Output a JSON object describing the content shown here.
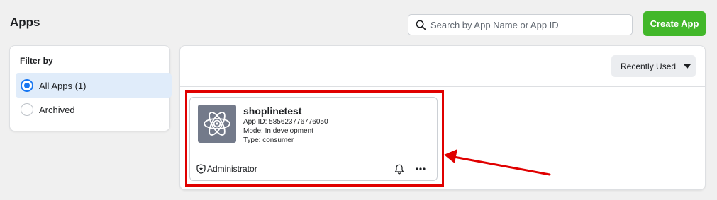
{
  "header": {
    "title": "Apps",
    "search_placeholder": "Search by App Name or App ID",
    "search_value": "",
    "create_label": "Create App"
  },
  "filter": {
    "title": "Filter by",
    "options": [
      {
        "label": "All Apps (1)",
        "selected": true
      },
      {
        "label": "Archived",
        "selected": false
      }
    ]
  },
  "sort": {
    "label": "Recently Used"
  },
  "app": {
    "name": "shoplinetest",
    "id_line": "App ID: 585623776776050",
    "mode_line": "Mode: In development",
    "type_line": "Type: consumer",
    "role": "Administrator",
    "icon": "atom-icon"
  },
  "colors": {
    "accent": "#1877f2",
    "create_button": "#42b72a",
    "annotation": "#e00000",
    "app_icon_bg": "#737a8a"
  }
}
